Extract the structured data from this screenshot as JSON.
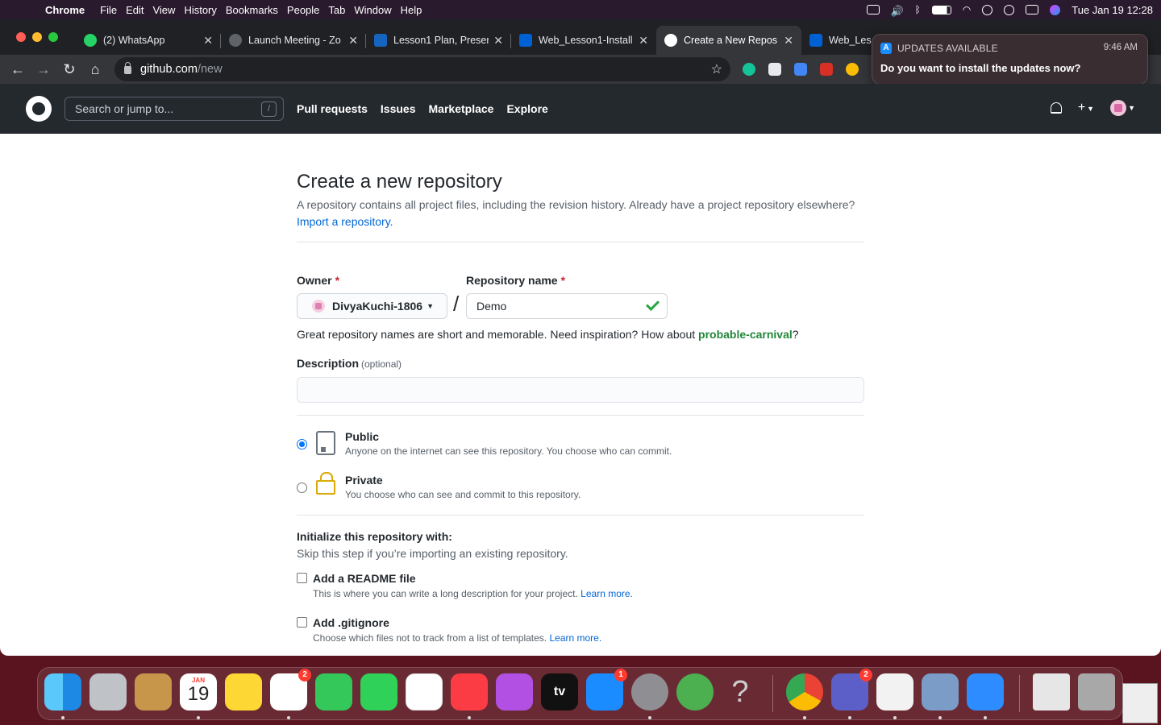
{
  "menubar": {
    "app": "Chrome",
    "items": [
      "File",
      "Edit",
      "View",
      "History",
      "Bookmarks",
      "People",
      "Tab",
      "Window",
      "Help"
    ],
    "datetime": "Tue Jan 19  12:28"
  },
  "tabs": [
    {
      "title": "(2) WhatsApp",
      "color": "#25d366"
    },
    {
      "title": "Launch Meeting - Zo",
      "color": "#5f6368"
    },
    {
      "title": "Lesson1 Plan, Preser",
      "color": "#1565c0"
    },
    {
      "title": "Web_Lesson1-Install",
      "color": "#0061d5"
    },
    {
      "title": "Create a New Repos",
      "color": "#ffffff"
    },
    {
      "title": "Web_Les",
      "color": "#0061d5"
    }
  ],
  "omnibox": {
    "host": "github.com",
    "path": "/new"
  },
  "notification": {
    "app": "UPDATES AVAILABLE",
    "time": "9:46 AM",
    "body": "Do you want to install the updates now?"
  },
  "github": {
    "search_placeholder": "Search or jump to...",
    "search_key": "/",
    "nav": [
      "Pull requests",
      "Issues",
      "Marketplace",
      "Explore"
    ],
    "plus": "+"
  },
  "form": {
    "title": "Create a new repository",
    "lead": "A repository contains all project files, including the revision history. Already have a project repository elsewhere?",
    "import_link": "Import a repository.",
    "owner_label": "Owner",
    "required_mark": "*",
    "owner_value": "DivyaKuchi-1806",
    "separator": "/",
    "repo_label": "Repository name",
    "repo_value": "Demo",
    "hint_prefix": "Great repository names are short and memorable. Need inspiration? How about",
    "hint_suggestion": "probable-carnival",
    "hint_suffix": "?",
    "description_label": "Description",
    "description_optional": "(optional)",
    "description_value": "",
    "visibility": [
      {
        "title": "Public",
        "desc": "Anyone on the internet can see this repository. You choose who can commit.",
        "selected": true
      },
      {
        "title": "Private",
        "desc": "You choose who can see and commit to this repository.",
        "selected": false
      }
    ],
    "init_title": "Initialize this repository with:",
    "init_sub": "Skip this step if you’re importing an existing repository.",
    "init_options": [
      {
        "title": "Add a README file",
        "desc": "This is where you can write a long description for your project.",
        "link": "Learn more."
      },
      {
        "title": "Add .gitignore",
        "desc": "Choose which files not to track from a list of templates.",
        "link": "Learn more."
      }
    ]
  },
  "dock": {
    "calendar_month": "JAN",
    "calendar_day": "19",
    "reminders_badge": "2",
    "appstore_badge": "1",
    "teams_badge": "2",
    "tv_label": "tv"
  }
}
